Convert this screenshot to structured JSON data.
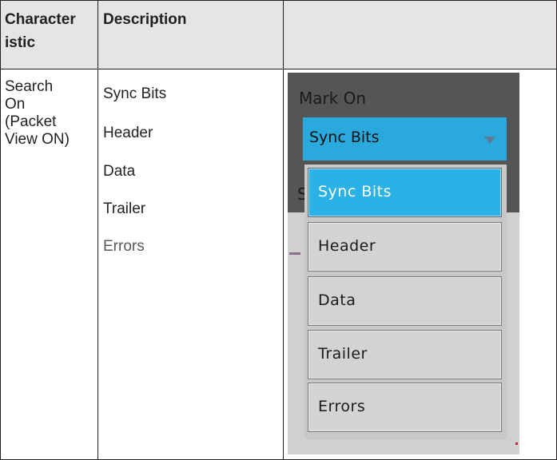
{
  "table": {
    "headers": {
      "characteristic": [
        "Character",
        "istic"
      ],
      "description": "Description",
      "third": ""
    },
    "row": {
      "characteristic": [
        "Search",
        "On",
        "(Packet",
        "View ON)"
      ],
      "description_items": [
        "Sync Bits",
        "Header",
        "Data",
        "Trailer",
        "Errors"
      ]
    }
  },
  "ui": {
    "mark_on_label": "Mark On",
    "selected_value": "Sync Bits",
    "background_glyph": "S",
    "options": [
      "Sync Bits",
      "Header",
      "Data",
      "Trailer",
      "Errors"
    ],
    "selected_index": 0,
    "colors": {
      "accent": "#2aa9dd",
      "panel": "#555555",
      "option_bg": "#d3d3d3"
    },
    "icons": [
      "chevron-down-icon"
    ]
  }
}
